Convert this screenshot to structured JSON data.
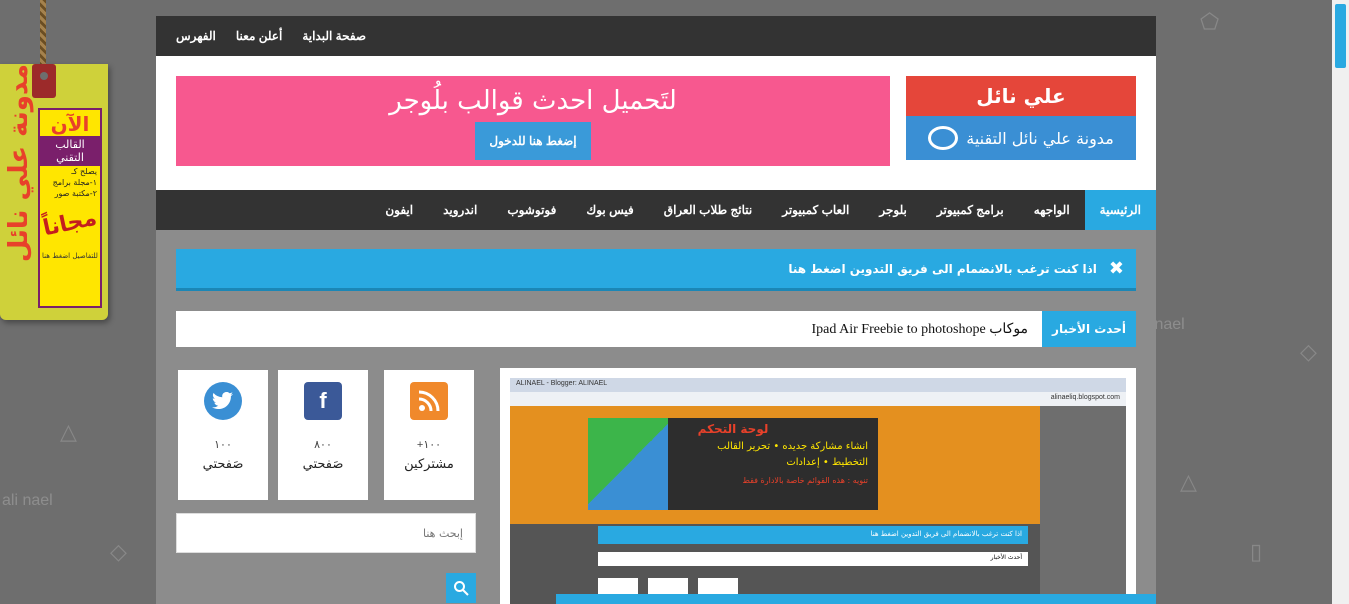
{
  "topbar": {
    "links": [
      "صفحة البداية",
      "أعلن معنا",
      "الفهرس"
    ]
  },
  "logo": {
    "title": "علي نائل",
    "subtitle": "مدونة علي نائل التقنية"
  },
  "banner": {
    "title": "لتَحميل احدث قوالب بلُوجر",
    "button": "إضغط هنا للدخول"
  },
  "nav": {
    "items": [
      "الرئيسية",
      "الواجهه",
      "برامج كمبيوتر",
      "بلوجر",
      "العاب كمبيوتر",
      "نتائج طلاب العراق",
      "فيس بوك",
      "فوتوشوب",
      "اندرويد",
      "ايفون"
    ],
    "active_index": 0
  },
  "notice": {
    "close": "✖",
    "text": "اذا كنت ترغب بالانضمام الى فريق التدوين اضغط هنا"
  },
  "ticker": {
    "label": "أحدث الأخبار",
    "headline_arabic": "موكاب",
    "headline_latin": "Ipad Air Freebie to photoshope"
  },
  "social": [
    {
      "name": "rss",
      "count": "+١٠٠",
      "label": "مشتركين",
      "color": "#f0892b",
      "glyph": "RSS"
    },
    {
      "name": "facebook",
      "count": "٨٠٠",
      "label": "صَفحتي",
      "color": "#3b5998",
      "glyph": "f"
    },
    {
      "name": "twitter",
      "count": "١٠٠",
      "label": "صَفحتي",
      "color": "#3a8fd4",
      "glyph": "t"
    }
  ],
  "search": {
    "placeholder": "إبحث هنا"
  },
  "side_tag": {
    "vertical_text": "مدونة علي نائل",
    "card_top": "القالب التقني",
    "now": "الآن",
    "lines": [
      "يصلح كـ",
      "١-مجلة برامج",
      "٢-مكتبة صور"
    ],
    "free": "مجاناً",
    "details": "للتفاصيل اضغط هنا"
  },
  "screenshot_preview": {
    "browser_tabs": "ALINAEL - Blogger: ALINAEL",
    "url": "alinaeliq.blogspot.com",
    "panel_title": "لوحة التحكم",
    "panel_line1": "انشاء مشاركة جديده • تحرير القالب",
    "panel_line2": "التخطيط • إعدادات",
    "panel_note": "تنويه : هذه القوائم خاصة بالادارة فقط",
    "blue_bar": "اذا كنت ترغب بالانضمام الى فريق التدوين اضغط هنا",
    "ticker": "أحدث الأخبار"
  },
  "watermark": "ali nael",
  "colors": {
    "accent": "#29a9e1",
    "dark": "#333333",
    "banner_pink": "#f7588f",
    "logo_red": "#e5463a"
  }
}
